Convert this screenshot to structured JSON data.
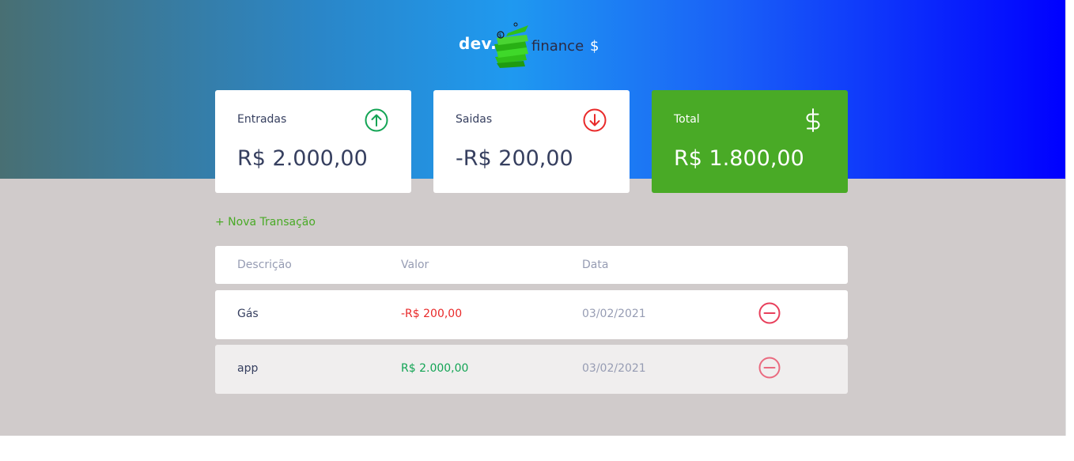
{
  "header": {
    "logo_dev": "dev.",
    "logo_finance": "finance",
    "logo_dollar": "$",
    "logo_icon": "money-stack-icon"
  },
  "cards": [
    {
      "label": "Entradas",
      "value": "R$ 2.000,00",
      "icon": "arrow-up-circle-icon",
      "color": "#12a454"
    },
    {
      "label": "Saidas",
      "value": "-R$ 200,00",
      "icon": "arrow-down-circle-icon",
      "color": "#e92929"
    },
    {
      "label": "Total",
      "value": "R$ 1.800,00",
      "icon": "dollar-icon",
      "color": "#49aa26"
    }
  ],
  "new_transaction_label": "+ Nova Transação",
  "table": {
    "headers": [
      "Descrição",
      "Valor",
      "Data"
    ],
    "rows": [
      {
        "description": "Gás",
        "amount": "-R$ 200,00",
        "date": "03/02/2021",
        "type": "expense",
        "action_icon": "minus-circle-icon"
      },
      {
        "description": "app",
        "amount": "R$ 2.000,00",
        "date": "03/02/2021",
        "type": "income",
        "action_icon": "minus-circle-icon"
      }
    ]
  },
  "colors": {
    "background": "#d0cbcb",
    "income": "#12a454",
    "expense": "#e92929",
    "total_card": "#49aa26",
    "text_dark": "#363f5f",
    "text_muted": "#969cb3"
  }
}
